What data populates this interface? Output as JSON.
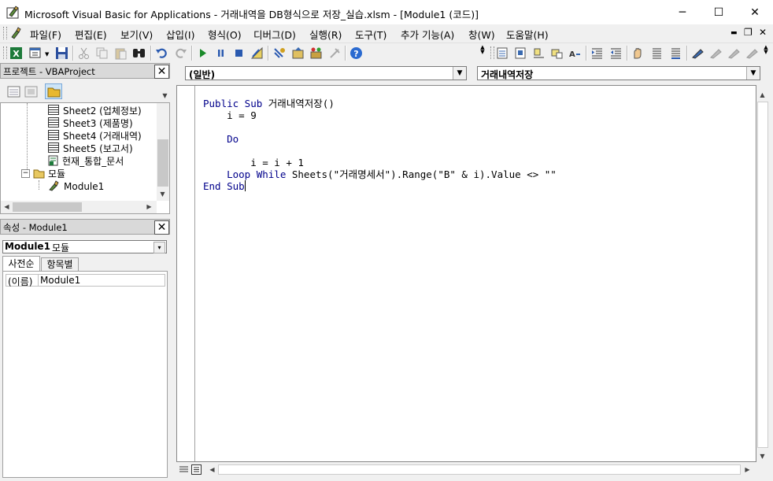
{
  "window": {
    "title": "Microsoft Visual Basic for Applications - 거래내역을 DB형식으로 저장_실습.xlsm - [Module1 (코드)]",
    "minimize": "─",
    "maximize": "☐",
    "close": "✕"
  },
  "menu": {
    "items": [
      "파일(F)",
      "편집(E)",
      "보기(V)",
      "삽입(I)",
      "형식(O)",
      "디버그(D)",
      "실행(R)",
      "도구(T)",
      "추가 기능(A)",
      "창(W)",
      "도움말(H)"
    ],
    "mdi_minimize": "▬",
    "mdi_restore": "❐",
    "mdi_close": "✕"
  },
  "project_pane": {
    "title": "프로젝트 - VBAProject",
    "close": "✕",
    "tree": [
      {
        "label": "Sheet2 (업체정보)",
        "icon": "sheet-icon"
      },
      {
        "label": "Sheet3 (제품명)",
        "icon": "sheet-icon"
      },
      {
        "label": "Sheet4 (거래내역)",
        "icon": "sheet-icon"
      },
      {
        "label": "Sheet5 (보고서)",
        "icon": "sheet-icon"
      },
      {
        "label": "현재_통합_문서",
        "icon": "workbook-icon"
      },
      {
        "label": "모듈",
        "icon": "folder-icon"
      },
      {
        "label": "Module1",
        "icon": "module-icon"
      }
    ],
    "expander": "⊟"
  },
  "properties_pane": {
    "title": "속성 - Module1",
    "close": "✕",
    "object_name": "Module1",
    "object_type": "모듈",
    "tabs": [
      "사전순",
      "항목별"
    ],
    "rows": [
      {
        "name": "(이름)",
        "value": "Module1"
      }
    ]
  },
  "code": {
    "object_combo": "(일반)",
    "proc_combo": "거래내역저장",
    "lines": [
      [
        {
          "t": "Public Sub",
          "k": 1
        },
        {
          "t": " 거래내역저장()",
          "k": 0
        }
      ],
      [
        {
          "t": "    i = 9",
          "k": 0
        }
      ],
      [
        {
          "t": "",
          "k": 0
        }
      ],
      [
        {
          "t": "    Do",
          "k": 1
        }
      ],
      [
        {
          "t": "",
          "k": 0
        }
      ],
      [
        {
          "t": "        i = i + 1",
          "k": 0
        }
      ],
      [
        {
          "t": "    Loop While",
          "k": 1
        },
        {
          "t": " Sheets(\"거래명세서\").Range(\"B\" & i).Value <> \"\"",
          "k": 0
        }
      ],
      [
        {
          "t": "End Sub",
          "k": 1
        }
      ]
    ]
  },
  "colors": {
    "keyword": "#00008b",
    "titlebar": "#ffffff",
    "chrome": "#f0f0f0"
  }
}
